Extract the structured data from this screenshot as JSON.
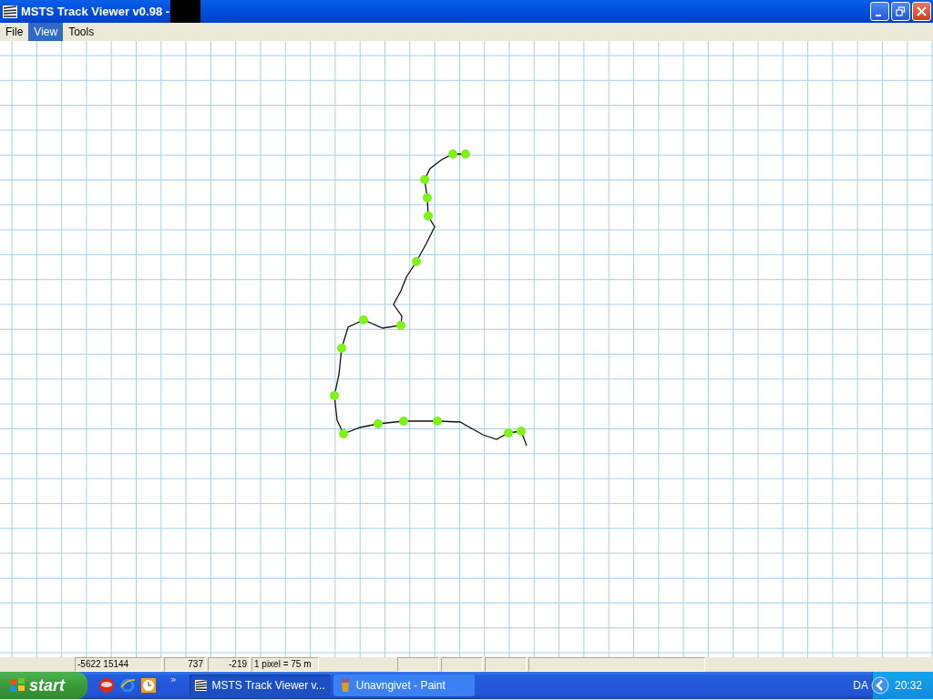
{
  "window": {
    "title": "MSTS Track Viewer v0.98 -",
    "title_redacted": true
  },
  "menu": [
    {
      "label": "File",
      "selected": false
    },
    {
      "label": "View",
      "selected": true
    },
    {
      "label": "Tools",
      "selected": false
    }
  ],
  "status_bar": [
    {
      "text": "-5622 15144",
      "kind": "text"
    },
    {
      "text": "737",
      "kind": "numeric"
    },
    {
      "text": "-219",
      "kind": "numeric"
    },
    {
      "text": "1 pixel = 75 m",
      "kind": "text"
    }
  ],
  "taskbar": {
    "start": "start",
    "tasks": [
      {
        "label": "MSTS Track Viewer v...",
        "selected": true,
        "kind": "track"
      },
      {
        "label": "Unavngivet - Paint",
        "selected": false,
        "kind": "paint"
      }
    ],
    "overflow": "»",
    "language": "DA",
    "clock": "20:32"
  }
}
